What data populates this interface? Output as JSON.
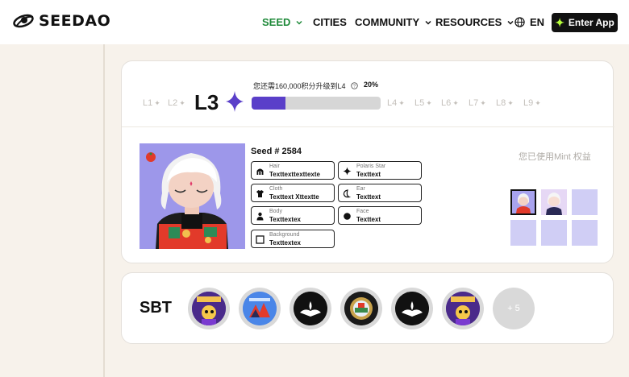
{
  "header": {
    "logo_text": "SEEDAO",
    "nav": [
      {
        "label": "SEED",
        "has_dropdown": true,
        "active": true
      },
      {
        "label": "CITIES",
        "has_dropdown": false
      },
      {
        "label": "COMMUNITY",
        "has_dropdown": true
      },
      {
        "label": "RESOURCES",
        "has_dropdown": true
      }
    ],
    "language": "EN",
    "enter_button": "Enter App"
  },
  "level": {
    "prev_levels": [
      "L1",
      "L2"
    ],
    "current": "L3",
    "next_levels": [
      "L4",
      "L5",
      "L6",
      "L7",
      "L8",
      "L9"
    ],
    "progress_text": "您还需160,000积分升级到L4",
    "progress_percent_label": "20%",
    "progress_fraction": 0.26
  },
  "seed": {
    "title": "Seed # 2584",
    "attributes": [
      {
        "label": "Hair",
        "value": "Texttexttexttexte",
        "icon": "hair-icon"
      },
      {
        "label": "Polaris Star",
        "value": "Texttext",
        "icon": "sparkle-icon"
      },
      {
        "label": "Cloth",
        "value": "Texttext Xttextte",
        "icon": "shirt-icon"
      },
      {
        "label": "Ear",
        "value": "Texttext",
        "icon": "moon-icon"
      },
      {
        "label": "Body",
        "value": "Texttextex",
        "icon": "person-icon"
      },
      {
        "label": "Face",
        "value": "Texttext",
        "icon": "circle-icon"
      },
      {
        "label": "Background",
        "value": "Texttextex",
        "icon": "square-icon"
      }
    ]
  },
  "mint": {
    "title": "您已使用Mint 权益"
  },
  "sbt": {
    "label": "SBT",
    "more_label": "+ 5"
  },
  "colors": {
    "accent_green": "#1f8a3a",
    "progress_fill": "#5a3fc9",
    "star_purple": "#5a3fc9",
    "slot_lavender": "#d0cef5"
  }
}
